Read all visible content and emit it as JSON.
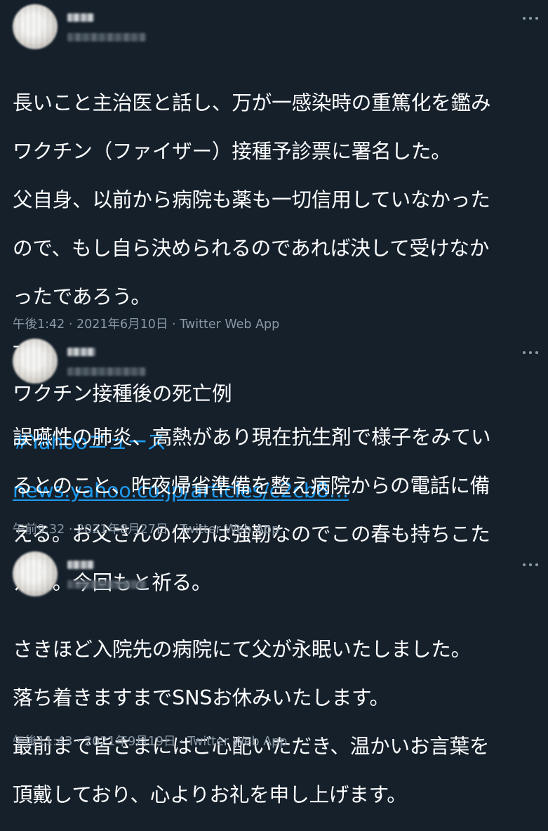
{
  "tweets": [
    {
      "more_label": "…",
      "lines": [
        "長いこと主治医と話し、万が一感染時の重篤化を鑑み",
        "ワクチン（ファイザー）接種予診票に署名した。",
        "父自身、以前から病院も薬も一切信用していなかった",
        "ので、もし自ら決められるのであれば決して受けなか",
        "ったであろう。",
        "--",
        "ワクチン接種後の死亡例"
      ],
      "hashtag": "#Yahooニュース",
      "link": "news.yahoo.co.jp/articles/c2cb8…",
      "time": "午後1:42 · 2021年6月10日",
      "separator": " · ",
      "app": "Twitter Web App"
    },
    {
      "more_label": "…",
      "lines": [
        "誤嚥性の肺炎、高熱があり現在抗生剤で様子をみてい",
        "るとのこと、昨夜帰省準備を整え病院からの電話に備",
        "える。お父さんの体力は強靭なのでこの春も持ちこた",
        "えた。今回もと祈る。"
      ],
      "time": "午前9:32 · 2021年8月27日",
      "separator": " · ",
      "app": "Twitter Web App"
    },
    {
      "more_label": "…",
      "lines": [
        "さきほど入院先の病院にて父が永眠いたしました。",
        "落ち着きますまでSNSお休みいたします。",
        "最前まで皆さまにはご心配いただき、温かいお言葉を",
        "頂戴しており、心よりお礼を申し上げます。"
      ],
      "time": "午後11:43 · 2021年9月19日",
      "separator": " · ",
      "app": "Twitter Web App"
    }
  ]
}
